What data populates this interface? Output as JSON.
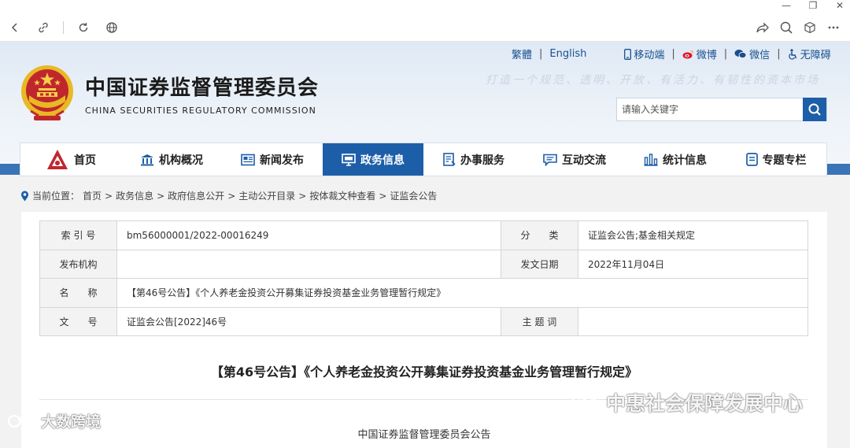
{
  "browser": {
    "window_buttons": [
      "—",
      "❐",
      "✕"
    ]
  },
  "header": {
    "links": {
      "traditional": "繁體",
      "english": "English",
      "mobile": "移动端",
      "weibo": "微博",
      "wechat": "微信",
      "accessibility": "无障碍"
    },
    "cn_title": "中国证券监督管理委员会",
    "en_title": "CHINA SECURITIES REGULATORY COMMISSION",
    "slogan": "打造一个规范、透明、开放、有活力、有韧性的资本市场",
    "search_placeholder": "请输入关键字"
  },
  "nav": {
    "items": [
      "首页",
      "机构概况",
      "新闻发布",
      "政务信息",
      "办事服务",
      "互动交流",
      "统计信息",
      "专题专栏"
    ],
    "active": "政务信息"
  },
  "breadcrumb": {
    "prefix": "当前位置：",
    "items": [
      "首页",
      "政务信息",
      "政府信息公开",
      "主动公开目录",
      "按体裁文种查看",
      "证监会公告"
    ],
    "separator": ">"
  },
  "info_table": {
    "index_label": "索 引 号",
    "index_value": "bm56000001/2022-00016249",
    "category_label": "分　　类",
    "category_value": "证监会公告;基金相关规定",
    "publisher_label": "发布机构",
    "publisher_value": "",
    "date_label": "发文日期",
    "date_value": "2022年11月04日",
    "name_label": "名　　称",
    "name_value": "【第46号公告】《个人养老金投资公开募集证券投资基金业务管理暂行规定》",
    "docno_label": "文　　号",
    "docno_value": "证监会公告[2022]46号",
    "subject_label": "主 题 词",
    "subject_value": ""
  },
  "document": {
    "title": "【第46号公告】《个人养老金投资公开募集证券投资基金业务管理暂行规定》",
    "issuer": "中国证券监督管理委员会公告"
  },
  "watermarks": {
    "right": "中惠社会保障发展中心",
    "left": "大数跨境"
  },
  "colors": {
    "primary_blue": "#1d5ea8",
    "band_blue": "#3a73b8",
    "emblem_red": "#c0272d",
    "emblem_gold": "#e8b923"
  }
}
